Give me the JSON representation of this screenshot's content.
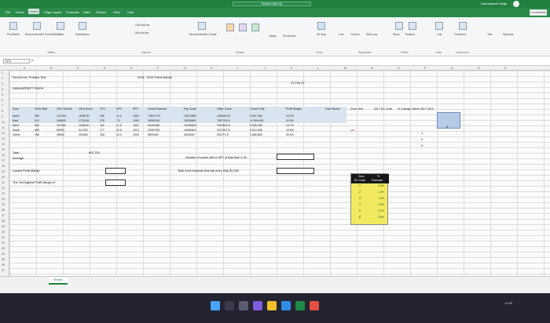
{
  "titlebar": {
    "search": "Search (Alt+Q)",
    "user": "Damanpreet Singh"
  },
  "tabs": [
    "File",
    "Home",
    "Insert",
    "Page Layout",
    "Formulas",
    "Data",
    "Review",
    "View",
    "Help"
  ],
  "active_tab": "Insert",
  "comments_label": "Comments",
  "ribbon": {
    "items": [
      "PivotTable",
      "Recommended PivotTables",
      "Table",
      "Illustrations",
      "Get Add-ins",
      "My Add-ins",
      "Recommended Charts",
      "Maps",
      "PivotChart",
      "3D Map",
      "Line",
      "Column",
      "Win/Loss",
      "Slicer",
      "Timeline",
      "Link",
      "Comment",
      "Text",
      "Symbols"
    ],
    "groups": [
      "Tables",
      "Add-ins",
      "Charts",
      "Tours",
      "Sparklines",
      "Filters",
      "Links",
      "Comments"
    ]
  },
  "formula": {
    "namebox": "Q11",
    "fx": "fx"
  },
  "columns": [
    "A",
    "B",
    "C",
    "D",
    "E",
    "F",
    "G",
    "H",
    "I",
    "J",
    "K",
    "L",
    "M",
    "N",
    "O",
    "P",
    "Q",
    "R",
    "S"
  ],
  "rows": [
    "1",
    "2",
    "3",
    "4",
    "5",
    "6",
    "7",
    "8",
    "9",
    "10",
    "11",
    "12",
    "13",
    "14",
    "15",
    "16",
    "17",
    "18",
    "19",
    "20",
    "21",
    "22",
    "23",
    "24",
    "25",
    "26",
    "27",
    "28",
    "29",
    "30",
    "31",
    "32",
    "33",
    "34",
    "35",
    "36",
    "37"
  ],
  "sheet": {
    "b1": "SenCal Inc. Practice Test",
    "title": "2016 - 2019 Client Activity",
    "date": "21-Feb-22",
    "name": "DAMANPREET SINGH",
    "headers": [
      "Zone",
      "2016 Staff",
      "2016 Clients",
      "2016 Hours",
      "CPC",
      "HPC",
      "RPC",
      "Gross Revenue",
      "Pay Costs",
      "Other Costs",
      "Gross Profit",
      "Profit Margin",
      "Zone Bonus",
      "Zone Vest",
      "2017 EC Code",
      "% Change Clients 2017-2019"
    ],
    "data": [
      [
        "North",
        "354",
        "141900",
        "1608730",
        "166",
        "11.4",
        "1004",
        "72847716",
        "12870600",
        "4456410 $",
        "5,497,306",
        "24.1%"
      ],
      [
        "East",
        "510",
        "245600",
        "1722161",
        "278",
        "7.0",
        "1090",
        "39592181",
        "15935600",
        "7557216 $",
        "11,999,945",
        "41.5%"
      ],
      [
        "West",
        "630",
        "101900",
        "1189440",
        "162",
        "11.6",
        "1002",
        "36493480",
        "24256600",
        "3322502 $",
        "5,905,938",
        "24.7%"
      ],
      [
        "South",
        "480",
        "85000",
        "917900",
        "177",
        "10.8",
        "1012",
        "23957900",
        "18480600",
        "2672912 $",
        "2,514,908",
        "10.6%"
      ],
      [
        "Home",
        "156",
        "28500",
        "294480",
        "183",
        "10.3",
        "1000",
        "5509400",
        "3000600",
        "303771 $",
        "1,668,689",
        "30.0%"
      ]
    ],
    "bonus_label": "yes",
    "total": "Total",
    "average": "Average",
    "avg_value": "602,700",
    "q1": "Lowest Profit Margin",
    "q2": "The 2nd highest Profit Margin of",
    "q3": "Number of zones with a HPC of less than 1.00",
    "q4": "Total Zone bonuses that are more than $1,000"
  },
  "forecast": {
    "h1": "Zone",
    "h2": "%",
    "h3": "EC Code",
    "h4": "Forecast",
    "rows": [
      {
        "zone": "1",
        "pct": "0.5%"
      },
      {
        "zone": "2",
        "pct": "1.4%"
      },
      {
        "zone": "3",
        "pct": "1.6%"
      },
      {
        "zone": "4",
        "pct": "2.5%"
      },
      {
        "zone": "5",
        "pct": "3.2%"
      },
      {
        "zone": "6",
        "pct": "3.8%"
      }
    ]
  },
  "side_codes": [
    "3",
    "1",
    "2",
    "3"
  ],
  "sheet_tab": "Sheet1",
  "clock": "12:45"
}
